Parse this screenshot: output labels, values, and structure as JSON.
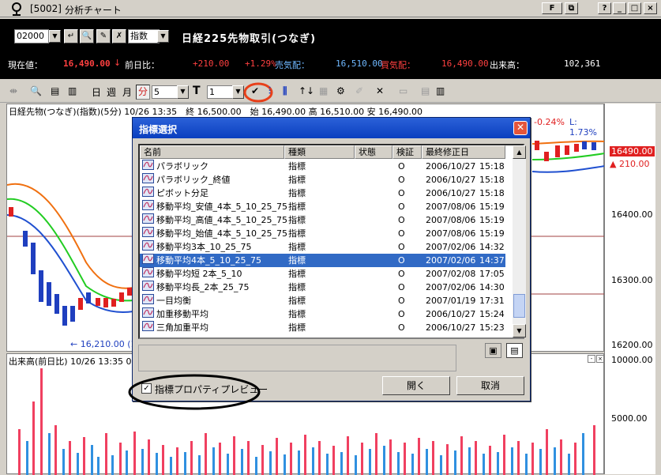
{
  "window": {
    "code": "[5002]",
    "title": "分析チャート",
    "ctrl_f": "F"
  },
  "header": {
    "code_value": "02000",
    "indicator_value": "指数",
    "instrument": "日経225先物取引(つなぎ)",
    "current_price_label": "現在値：",
    "current_price": "16,490.00",
    "arrow": "↓",
    "prev_compare_label": "前日比：",
    "prev_change": "+210.00",
    "prev_change_pct": "+1.29%",
    "ask_label": "売気配：",
    "ask_value": "16,510.00",
    "bid_label": "買気配：",
    "bid_value": "16,490.00",
    "volume_label": "出来高：",
    "volume_value": "102,361"
  },
  "toolbar": {
    "day": "日",
    "week": "週",
    "month": "月",
    "minute": "分",
    "interval": "5",
    "type_value": "1"
  },
  "chart": {
    "info": "日経先物(つなぎ)(指数)(5分) 10/26 13:35　終 16,500.00　始 16,490.00 高 16,510.00 安 16,490.00",
    "pct_change": "-0.24%",
    "low_label": "L: 1.73%",
    "low_marker": "← 16,210.00 (10",
    "last_price_tag": "16490.00",
    "change_tag": "▲ 210.00",
    "price_ticks": [
      "16400.00",
      "16300.00",
      "16200.00"
    ],
    "volume_info": "出来高(前日比) 10/26 13:35 0",
    "volume_ticks": [
      "10000.00",
      "5000.00"
    ]
  },
  "dialog": {
    "title": "指標選択",
    "columns": [
      "名前",
      "種類",
      "状態",
      "検証",
      "最終修正日"
    ],
    "rows": [
      {
        "name": "パラボリック",
        "type": "指標",
        "status": "",
        "verify": "O",
        "date": "2006/10/27",
        "time": "15:18"
      },
      {
        "name": "パラボリック_終値",
        "type": "指標",
        "status": "",
        "verify": "O",
        "date": "2006/10/27",
        "time": "15:18"
      },
      {
        "name": "ピボット分足",
        "type": "指標",
        "status": "",
        "verify": "O",
        "date": "2006/10/27",
        "time": "15:18"
      },
      {
        "name": "移動平均_安値_4本_5_10_25_75",
        "type": "指標",
        "status": "",
        "verify": "O",
        "date": "2007/08/06",
        "time": "15:19"
      },
      {
        "name": "移動平均_高値_4本_5_10_25_75",
        "type": "指標",
        "status": "",
        "verify": "O",
        "date": "2007/08/06",
        "time": "15:19"
      },
      {
        "name": "移動平均_始値_4本_5_10_25_75",
        "type": "指標",
        "status": "",
        "verify": "O",
        "date": "2007/08/06",
        "time": "15:19"
      },
      {
        "name": "移動平均3本_10_25_75",
        "type": "指標",
        "status": "",
        "verify": "O",
        "date": "2007/02/06",
        "time": "14:32"
      },
      {
        "name": "移動平均4本_5_10_25_75",
        "type": "指標",
        "status": "",
        "verify": "O",
        "date": "2007/02/06",
        "time": "14:37"
      },
      {
        "name": "移動平均短 2本_5_10",
        "type": "指標",
        "status": "",
        "verify": "O",
        "date": "2007/02/08",
        "time": "17:05"
      },
      {
        "name": "移動平均長_2本_25_75",
        "type": "指標",
        "status": "",
        "verify": "O",
        "date": "2007/02/06",
        "time": "14:30"
      },
      {
        "name": "一目均衡",
        "type": "指標",
        "status": "",
        "verify": "O",
        "date": "2007/01/19",
        "time": "17:31"
      },
      {
        "name": "加重移動平均",
        "type": "指標",
        "status": "",
        "verify": "O",
        "date": "2006/10/27",
        "time": "15:24"
      },
      {
        "name": "三角加重平均",
        "type": "指標",
        "status": "",
        "verify": "O",
        "date": "2006/10/27",
        "time": "15:23"
      }
    ],
    "checkbox_label": "指標プロパティプレビュー",
    "checkbox_mark": "✓",
    "open_button": "開く",
    "cancel_button": "取消"
  },
  "colors": {
    "selected_row": "#316ac5",
    "candle_up": "#e02020",
    "candle_down": "#1f3fbf",
    "ma_orange": "#f07010",
    "ma_green": "#22cc22",
    "ma_blue": "#2050d0",
    "volume_red": "#f04060",
    "volume_blue": "#3090e0",
    "annotation_red": "#e8401a"
  }
}
